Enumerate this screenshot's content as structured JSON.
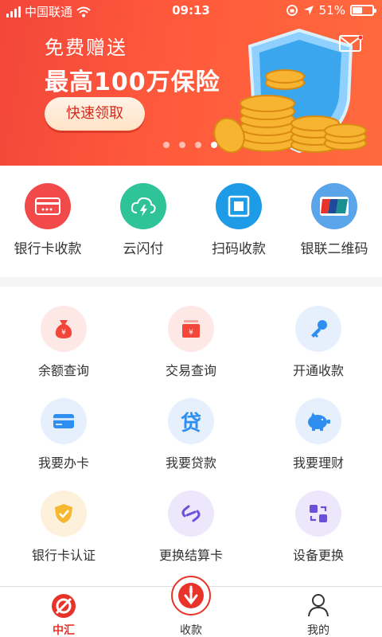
{
  "status_bar": {
    "carrier": "中国联通",
    "time": "09:13",
    "battery": "51%",
    "battery_level": 0.51
  },
  "banner": {
    "line1": "免费赠送",
    "line2": "最高100万保险",
    "cta": "快速领取",
    "slide_count": 4,
    "active_slide": 4,
    "colors": {
      "bg": "#f2463a",
      "cta_text": "#d62a1e"
    }
  },
  "quick_actions": [
    {
      "label": "银行卡收款",
      "icon": "bank-card-icon",
      "color": "#f24a4a"
    },
    {
      "label": "云闪付",
      "icon": "cloud-flash-pay-icon",
      "color": "#2fc39a"
    },
    {
      "label": "扫码收款",
      "icon": "scan-code-icon",
      "color": "#1e9be6"
    },
    {
      "label": "银联二维码",
      "icon": "unionpay-icon",
      "color": "#5aa4ea"
    }
  ],
  "services": [
    {
      "label": "余额查询",
      "icon": "money-bag-icon"
    },
    {
      "label": "交易查询",
      "icon": "transaction-icon"
    },
    {
      "label": "开通收款",
      "icon": "key-icon"
    },
    {
      "label": "我要办卡",
      "icon": "card-icon"
    },
    {
      "label": "我要贷款",
      "icon": "loan-icon",
      "glyph": "贷"
    },
    {
      "label": "我要理财",
      "icon": "piggy-bank-icon"
    },
    {
      "label": "银行卡认证",
      "icon": "shield-check-icon"
    },
    {
      "label": "更换结算卡",
      "icon": "swap-link-icon"
    },
    {
      "label": "设备更换",
      "icon": "device-swap-icon"
    }
  ],
  "tabbar": {
    "tabs": [
      {
        "label": "中汇",
        "icon": "home-logo-icon",
        "active": true
      },
      {
        "label": "收款",
        "icon": "receive-money-icon",
        "active": false
      },
      {
        "label": "我的",
        "icon": "user-icon",
        "active": false
      }
    ],
    "active_color": "#e8332a"
  }
}
